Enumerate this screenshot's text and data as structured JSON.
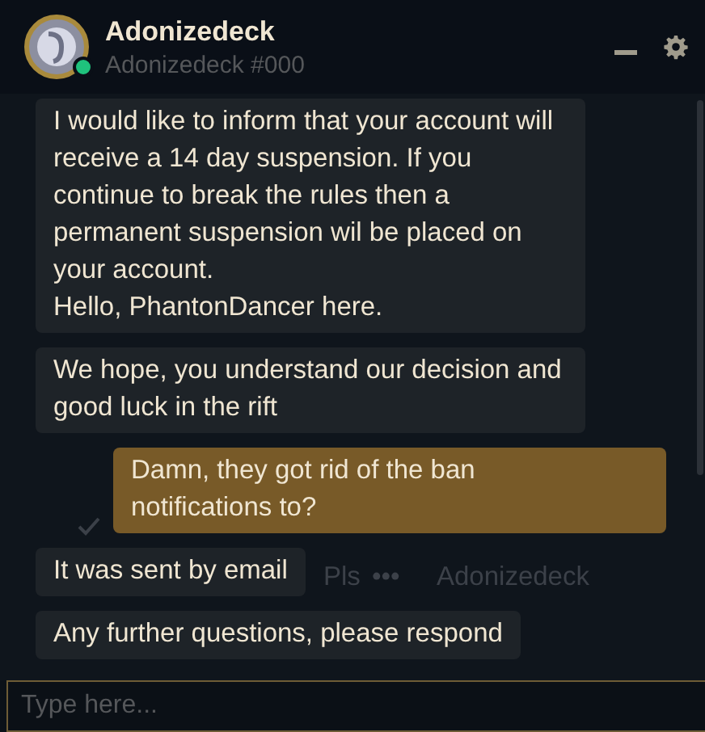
{
  "header": {
    "name": "Adonizedeck",
    "tag": "Adonizedeck #000",
    "online": true
  },
  "background": {
    "texts": [
      "Pls",
      "•••",
      "Adonizedeck"
    ]
  },
  "messages": [
    {
      "outgoing": false,
      "text": "I would like to inform that your account will receive a 14 day suspension. If you continue to break the rules then a permanent suspension wil be placed on your account.\nHello, PhantonDancer here."
    },
    {
      "outgoing": false,
      "text": "We hope, you understand our decision and good luck in the rift"
    },
    {
      "outgoing": true,
      "text": "Damn, they got rid of the ban notifications to?"
    },
    {
      "outgoing": false,
      "text": "It was sent by email"
    },
    {
      "outgoing": false,
      "text": "Any further questions, please respond"
    }
  ],
  "input": {
    "placeholder": "Type here..."
  }
}
